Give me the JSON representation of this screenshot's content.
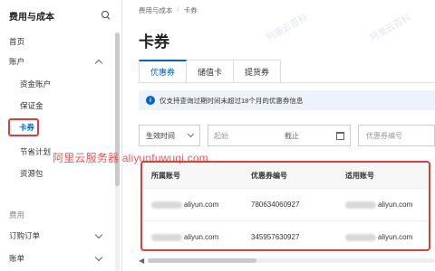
{
  "sidebar": {
    "title": "费用与成本",
    "items": [
      {
        "label": "首页"
      },
      {
        "label": "账户"
      },
      {
        "label": "资金账户"
      },
      {
        "label": "保证金"
      },
      {
        "label": "卡券"
      },
      {
        "label": "节省计划"
      },
      {
        "label": "资源包"
      },
      {
        "label": "费用"
      },
      {
        "label": "订购订单"
      },
      {
        "label": "账单"
      }
    ]
  },
  "breadcrumb": [
    "费用与成本",
    "卡券"
  ],
  "page_title": "卡券",
  "tabs": [
    {
      "label": "优惠券",
      "active": true
    },
    {
      "label": "储值卡"
    },
    {
      "label": "提货券"
    }
  ],
  "notice": "仅支持查询过期时间未超过18个月的优惠券信息",
  "filters": {
    "select_value": "生效时间",
    "date_start_placeholder": "起始",
    "date_end_placeholder": "截止",
    "coupon_placeholder": "优惠券编号"
  },
  "table": {
    "headers": [
      "所属账号",
      "优惠券编号",
      "适用账号"
    ],
    "rows": [
      {
        "owner": "aliyun.com",
        "coupon_id": "780634060927",
        "applicable": "aliyun.com"
      },
      {
        "owner": "aliyun.com",
        "coupon_id": "345957630927",
        "applicable": "aliyun.com"
      }
    ]
  },
  "watermark": {
    "text": "阿里云服务器 aliyunfuwuqi.com",
    "faint": "阿里云百科"
  },
  "colors": {
    "accent": "#0064c8",
    "highlight": "#e23b3b"
  }
}
